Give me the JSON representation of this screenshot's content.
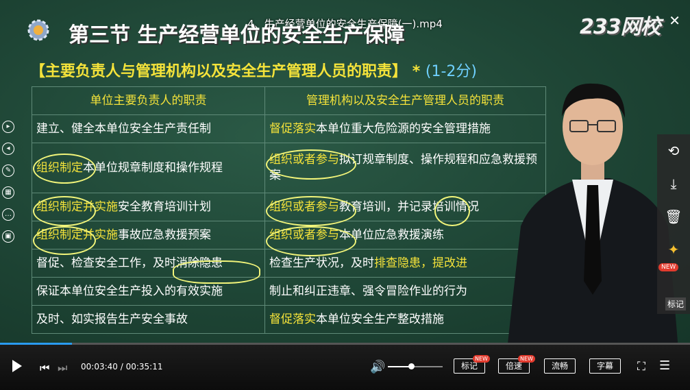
{
  "video_title": "4、生产经营单位的安全生产保障(一).mp4",
  "logo": "233网校",
  "slide": {
    "section_title": "第三节 生产经营单位的安全生产保障",
    "subtitle": "【主要负责人与管理机构以及安全生产管理人员的职责】",
    "star": "*",
    "points": "(1-2分)",
    "headers": [
      "单位主要负责人的职责",
      "管理机构以及安全生产管理人员的职责"
    ],
    "rows": [
      {
        "left": "建立、健全本单位安全生产责任制",
        "right_hl": "督促落实",
        "right": "本单位重大危险源的安全管理措施"
      },
      {
        "left_hl": "组织制定",
        "left": "本单位规章制度和操作规程",
        "right_hl": "组织或者参与",
        "right": "拟订规章制度、操作规程和应急救援预案"
      },
      {
        "left_hl": "组织制定并实施",
        "left": "安全教育培训计划",
        "right_hl": "组织或者参与",
        "right": "教育培训，并记录培训情况"
      },
      {
        "left_hl": "组织制定并实施",
        "left": "事故应急救援预案",
        "right_hl": "组织或者参与",
        "right": "本单位应急救援演练"
      },
      {
        "left": "督促、检查安全工作，及时消除隐患",
        "right": "检查生产状况，及时",
        "right_hl": "排查隐患，提改进",
        "right_after": ""
      },
      {
        "left": "保证本单位安全生产投入的有效实施",
        "right": "制止和纠正违章、强令冒险作业的行为"
      },
      {
        "left": "及时、如实报告生产安全事故",
        "right_hl": "督促落实",
        "right": "本单位安全生产整改措施"
      }
    ]
  },
  "right_panel": {
    "items": [
      "share-icon",
      "download-icon",
      "delete-icon",
      "pin-icon"
    ],
    "new_badge": "NEW",
    "label": "标记"
  },
  "player": {
    "time": "00:03:40 / 00:35:11",
    "progress": 0.104,
    "volume": 0.42,
    "buttons": [
      {
        "label": "标记",
        "new": "NEW"
      },
      {
        "label": "倍速",
        "new": "NEW"
      },
      {
        "label": "流畅",
        "new": ""
      },
      {
        "label": "字幕",
        "new": ""
      }
    ]
  }
}
